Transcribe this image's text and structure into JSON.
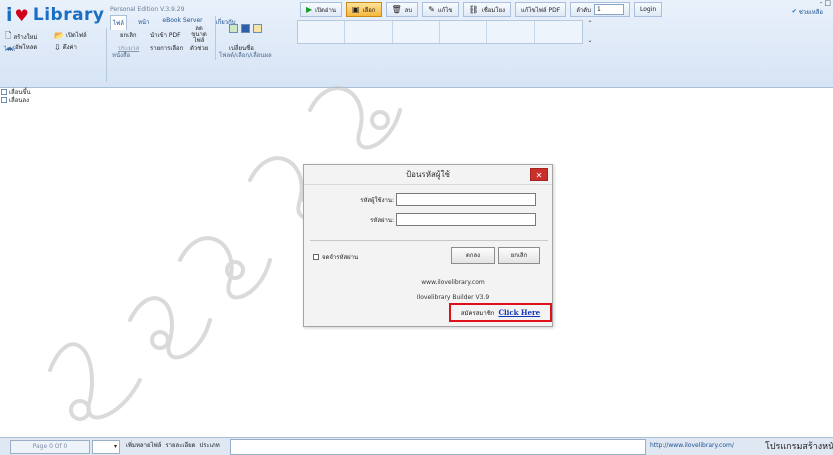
{
  "app": {
    "logo_i": "i",
    "logo_heart": "♥",
    "logo_text": "Library",
    "edition": "Personal Edition V.3.9.29"
  },
  "menu_tabs": [
    {
      "label": "ไฟล์",
      "active": true
    },
    {
      "label": "หน้า",
      "active": false
    },
    {
      "label": "eBook Server",
      "active": false
    },
    {
      "label": "เกี่ยวกับ",
      "active": false
    }
  ],
  "toolbar": {
    "open_label": "เปิดอ่าน",
    "select_label": "เลือก",
    "delete_label": "ลบ",
    "edit_label": "แก้ไข",
    "link_label": "เชื่อมโยง",
    "pdf_label": "แก้ไขไฟล์ PDF",
    "sequence_label": "ลำดับ",
    "page_value": "1",
    "login_label": "Login",
    "help_label": "ช่วยเหลือ",
    "window_controls": "- □"
  },
  "ribbon": {
    "file_group": {
      "label": "ไฟล์",
      "create": "สร้างใหม่",
      "open": "เปิดไฟล์",
      "upload": "อัพโหลด",
      "download": "ดึงค่า"
    },
    "book_group": {
      "label": "หนังสือ",
      "cancel": "ยกเลิก",
      "import_pdf": "นำเข้า PDF",
      "size": "ลดขนาด ไฟล์",
      "convert": "ประมวล",
      "select_list": "รายการเลือก",
      "check": "ตัวช่วย"
    },
    "folder_group": {
      "label": "โฟลด์/เลือก/เลื่อนผล",
      "rename": "เปลี่ยนชื่อ"
    }
  },
  "tree": [
    {
      "label": "เลื่อนขึ้น"
    },
    {
      "label": "เลื่อนลง"
    }
  ],
  "login_dialog": {
    "title": "ป้อนรหัสผู้ใช้",
    "close": "✕",
    "username_label": "รหัสผู้ใช้งาน:",
    "username_value": "",
    "password_label": "รหัสผ่าน:",
    "password_value": "",
    "remember_label": "จดจำรหัสผ่าน",
    "ok_label": "ตกลง",
    "cancel_label": "ยกเลิก",
    "website": "www.ilovelibrary.com",
    "builder": "Ilovelibrary Builder V3.9",
    "register_label": "สมัครสมาชิก",
    "register_link": "Click Here"
  },
  "statusbar": {
    "page": "Page 0 Of 0",
    "select_arrow": "▾",
    "links": [
      "เพิ่มหลายไฟล์",
      "รายละเอียด",
      "ประเภท"
    ],
    "url": "http://www.ilovelibrary.com/",
    "message": "โปรแกรมสร้างหนังสือ"
  },
  "colors": {
    "accent": "#1b6fc2",
    "selected": "#f6b73c",
    "highlight": "#e0101a",
    "link": "#1034b4"
  }
}
